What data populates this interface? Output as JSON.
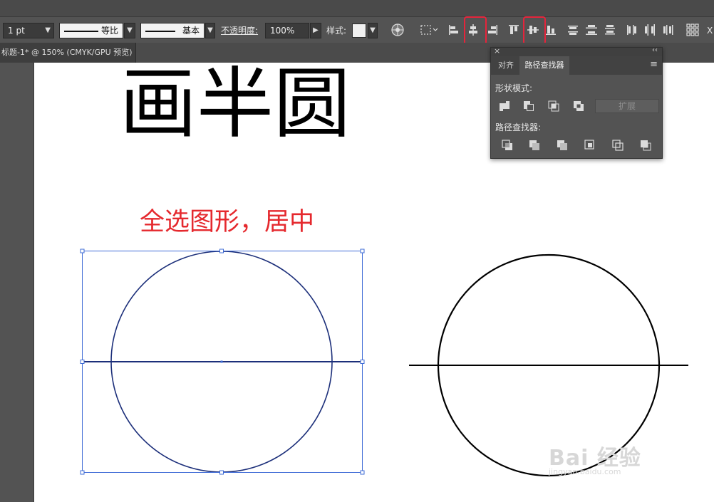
{
  "control_bar": {
    "stroke_weight": "1 pt",
    "variable_width_label": "等比",
    "brush_label": "基本",
    "opacity_label": "不透明度:",
    "opacity_value": "100%",
    "style_label": "样式:",
    "partial_label": "X"
  },
  "document_tab": {
    "title": "标题-1* @ 150% (CMYK/GPU 预览)"
  },
  "canvas": {
    "heading": "画半圆",
    "annotation": "全选图形，居中",
    "annotation_color": "#e5292e"
  },
  "pathfinder_panel": {
    "tabs": [
      "对齐",
      "路径查找器"
    ],
    "active_tab": "路径查找器",
    "shape_modes_label": "形状模式:",
    "expand_label": "扩展",
    "pathfinders_label": "路径查找器:"
  },
  "highlights": {
    "color": "#e5243b",
    "targets": [
      "horizontal-align-center",
      "vertical-align-center"
    ]
  },
  "watermark": {
    "brand": "Bai 经验",
    "url": "jingyan.baidu.com"
  }
}
